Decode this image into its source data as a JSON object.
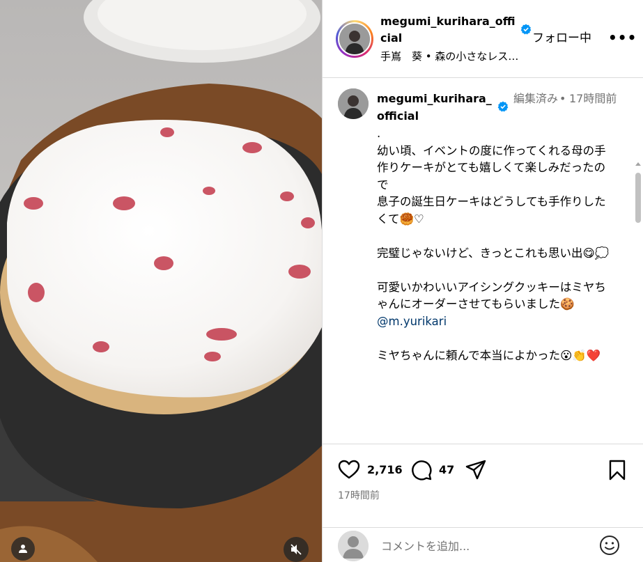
{
  "header": {
    "username": "megumi_kurihara_official",
    "follow_status": "フォロー中",
    "more": "•••",
    "location": "手嶌　葵 • 森の小さなレス…"
  },
  "caption": {
    "username": "megumi_kurihara_official",
    "edited": "編集済み",
    "dot": "•",
    "time": "17時間前",
    "lines": {
      "p1": ".\n幼い頃、イベントの度に作ってくれる母の手作りケーキがとても嬉しくて楽しみだったので\n息子の誕生日ケーキはどうしても手作りしたくて🥮♡",
      "p2": "完璧じゃないけど、きっとこれも思い出😋💭",
      "p3": "可愛いかわいいアイシングクッキーはミヤちゃんにオーダーさせてもらいました🍪",
      "mention": "@m.yurikari",
      "p4": "ミヤちゃんに頼んで本当によかった😮👏❤️"
    }
  },
  "actions": {
    "like_count": "2,716",
    "comment_count": "47",
    "post_time": "17時間前"
  },
  "comment_bar": {
    "placeholder": "コメントを追加..."
  },
  "colors": {
    "verified": "#0095f6",
    "mention": "#00376b",
    "muted": "#737373",
    "divider": "#dbdbdb"
  },
  "icons": [
    "user-tag-icon",
    "mute-icon",
    "verified-icon",
    "heart-icon",
    "comment-icon",
    "share-icon",
    "save-icon",
    "emoji-icon"
  ]
}
